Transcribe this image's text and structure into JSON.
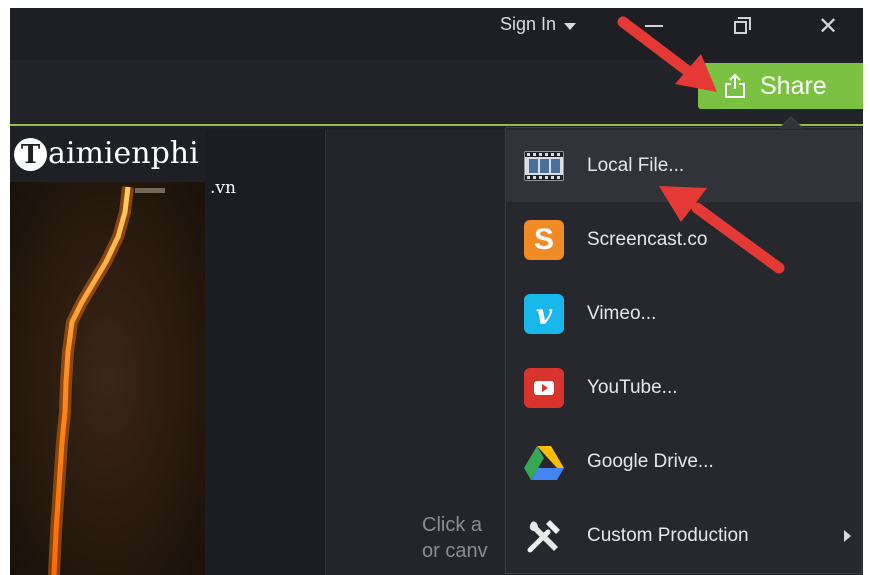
{
  "titlebar": {
    "sign_in_label": "Sign In",
    "close_glyph": "✕"
  },
  "toolbar": {
    "share_label": "Share"
  },
  "watermark": {
    "brand_t": "T",
    "brand_rest": "aimienphi",
    "brand_domain": ".vn"
  },
  "canvas": {
    "hint_line1": "Click a",
    "hint_line2": "or canv"
  },
  "share_menu": {
    "items": [
      {
        "label": "Local File...",
        "icon": "film-icon"
      },
      {
        "label": "Screencast.co",
        "icon": "screencast-icon"
      },
      {
        "label": "Vimeo...",
        "icon": "vimeo-icon"
      },
      {
        "label": "YouTube...",
        "icon": "youtube-icon"
      },
      {
        "label": "Google Drive...",
        "icon": "google-drive-icon"
      },
      {
        "label": "Custom Production",
        "icon": "tools-icon"
      }
    ]
  },
  "colors": {
    "share_green": "#7cc242",
    "arrow_red": "#e53935",
    "screencast_orange": "#f08a24",
    "vimeo_blue": "#1ab7ea",
    "youtube_red": "#d9342b"
  }
}
